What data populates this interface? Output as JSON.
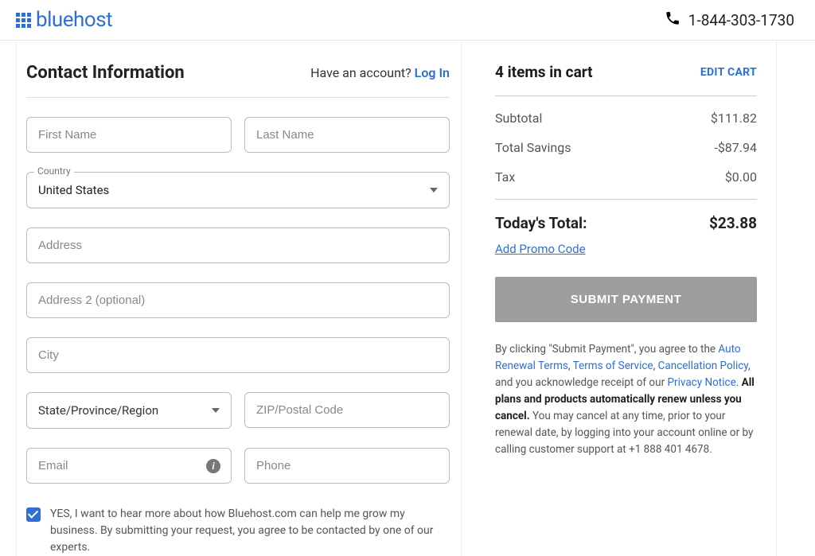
{
  "header": {
    "brand": "bluehost",
    "phone": "1-844-303-1730"
  },
  "contact": {
    "title": "Contact Information",
    "account_prompt": "Have an account? ",
    "login_label": "Log In",
    "first_name_ph": "First Name",
    "last_name_ph": "Last Name",
    "country_label": "Country",
    "country_value": "United States",
    "address_ph": "Address",
    "address2_ph": "Address 2 (optional)",
    "city_ph": "City",
    "region_ph": "State/Province/Region",
    "zip_ph": "ZIP/Postal Code",
    "email_ph": "Email",
    "phone_ph": "Phone",
    "consent_text": "YES, I want to hear more about how Bluehost.com can help me grow my business. By submitting your request, you agree to be contacted by one of our experts."
  },
  "cart": {
    "heading": "4 items in cart",
    "edit_label": "EDIT CART",
    "subtotal_label": "Subtotal",
    "subtotal_value": "$111.82",
    "savings_label": "Total Savings",
    "savings_value": "-$87.94",
    "tax_label": "Tax",
    "tax_value": "$0.00",
    "total_label": "Today's Total:",
    "total_value": "$23.88",
    "promo_label": "Add Promo Code",
    "submit_label": "SUBMIT PAYMENT"
  },
  "legal": {
    "prefix": "By clicking \"Submit Payment\", you agree to the ",
    "auto_renewal": "Auto Renewal Terms",
    "tos": "Terms of Service",
    "cancellation": "Cancellation Policy",
    "ack": ", and you acknowledge receipt of our ",
    "privacy": "Privacy Notice",
    "renew_bold": "All plans and products automatically renew unless you cancel.",
    "tail": " You may cancel at any time, prior to your renewal date, by logging into your account online or by calling customer support at +1 888 401 4678."
  }
}
